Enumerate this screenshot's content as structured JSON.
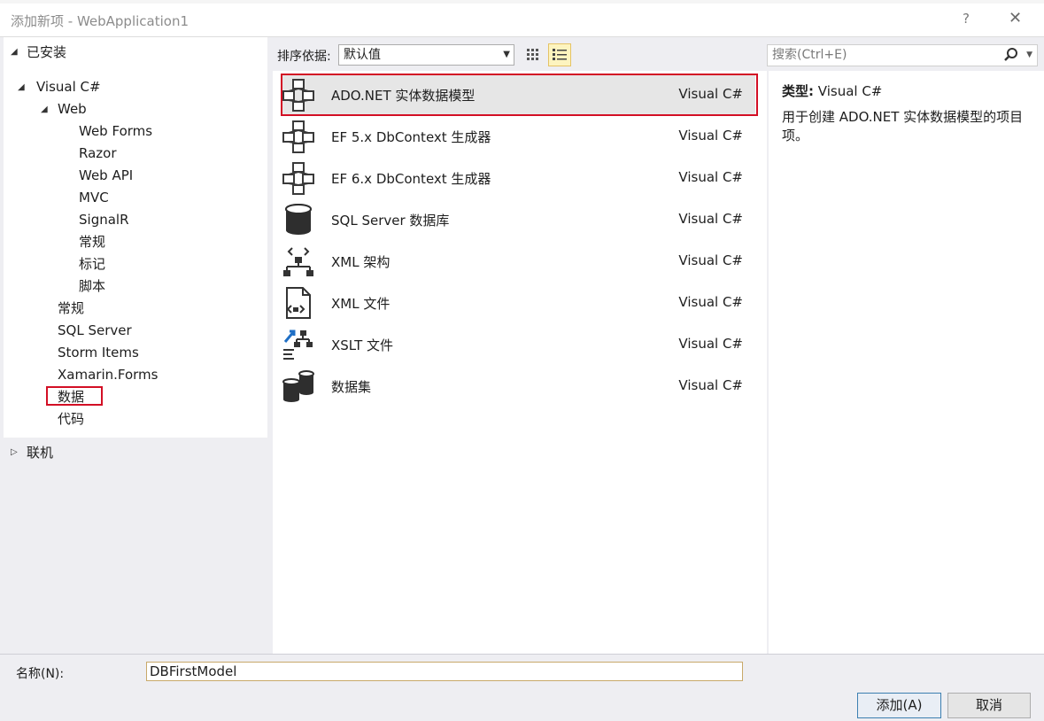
{
  "window": {
    "title": "添加新项 - WebApplication1",
    "help_label": "?",
    "close_label": "✕"
  },
  "tree": {
    "installed": "已安装",
    "visual_csharp": "Visual C#",
    "web": "Web",
    "web_children": [
      "Web Forms",
      "Razor",
      "Web API",
      "MVC",
      "SignalR",
      "常规",
      "标记",
      "脚本"
    ],
    "csharp_children": [
      "常规",
      "SQL Server",
      "Storm Items",
      "Xamarin.Forms",
      "数据",
      "代码"
    ],
    "online": "联机",
    "selected": "数据"
  },
  "toolbar": {
    "sort_label": "排序依据:",
    "sort_value": "默认值",
    "search_placeholder": "搜索(Ctrl+E)"
  },
  "items": [
    {
      "name": "ADO.NET 实体数据模型",
      "lang": "Visual C#",
      "icon": "entity-model-icon"
    },
    {
      "name": "EF 5.x DbContext 生成器",
      "lang": "Visual C#",
      "icon": "entity-model-icon"
    },
    {
      "name": "EF 6.x DbContext 生成器",
      "lang": "Visual C#",
      "icon": "entity-model-icon"
    },
    {
      "name": "SQL Server 数据库",
      "lang": "Visual C#",
      "icon": "database-icon"
    },
    {
      "name": "XML 架构",
      "lang": "Visual C#",
      "icon": "xml-schema-icon"
    },
    {
      "name": "XML 文件",
      "lang": "Visual C#",
      "icon": "xml-file-icon"
    },
    {
      "name": "XSLT 文件",
      "lang": "Visual C#",
      "icon": "xslt-file-icon"
    },
    {
      "name": "数据集",
      "lang": "Visual C#",
      "icon": "dataset-icon"
    }
  ],
  "selected_item": "ADO.NET 实体数据模型",
  "details": {
    "type_label": "类型:",
    "type_value": "Visual C#",
    "description": "用于创建 ADO.NET 实体数据模型的项目项。"
  },
  "form": {
    "name_label": "名称(N):",
    "name_value": "DBFirstModel"
  },
  "buttons": {
    "add": "添加(A)",
    "cancel": "取消"
  },
  "colors": {
    "highlight_red": "#d30f25",
    "selected_row": "#e6e6e6",
    "active_view": "#fdf4bf"
  }
}
